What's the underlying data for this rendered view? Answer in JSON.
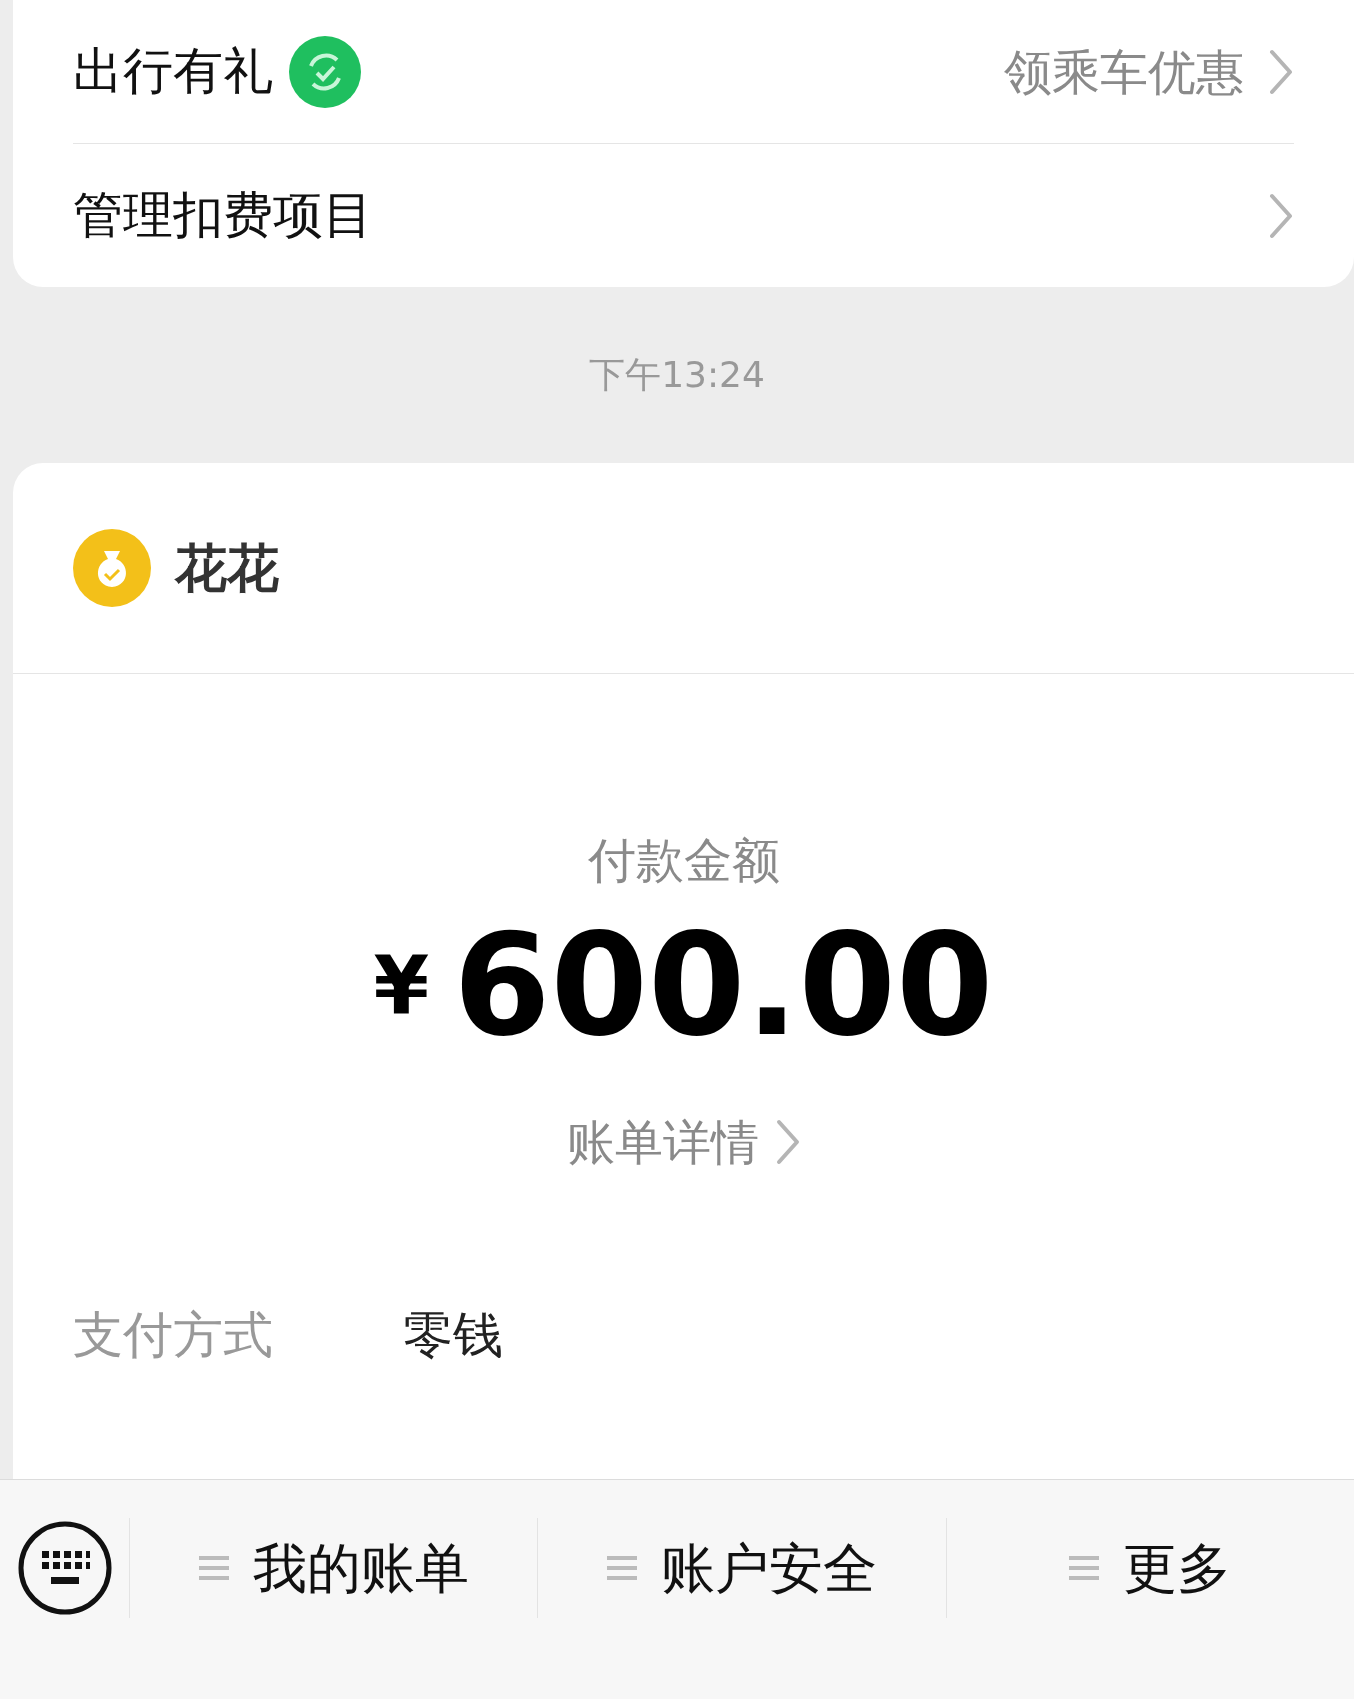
{
  "service_card": {
    "rows": [
      {
        "kind": "promo",
        "label": "出行有礼",
        "value": "领乘车优惠"
      },
      {
        "kind": "plain",
        "label": "管理扣费项目"
      }
    ]
  },
  "timestamp": "下午13:24",
  "payment_card": {
    "merchant": "花花",
    "amount_label": "付款金额",
    "currency": "¥",
    "amount": "600.00",
    "details_link": "账单详情",
    "method_label": "支付方式",
    "method_value": "零钱"
  },
  "bottom_menu": [
    "我的账单",
    "账户安全",
    "更多"
  ]
}
